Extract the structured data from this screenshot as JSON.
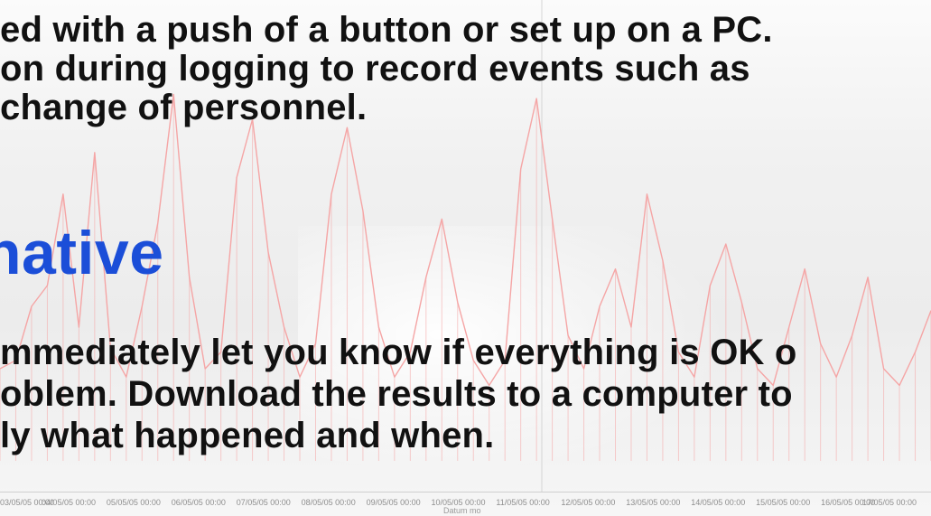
{
  "slide": {
    "lines": [
      "ed with a push of a button or set up on a PC.",
      "on during logging to record events such as",
      "change of personnel."
    ],
    "heading": "native",
    "body": [
      "mmediately let you know if everything is OK o",
      "oblem. Download the results to a computer to",
      "ly what happened and when."
    ]
  },
  "chart_data": {
    "type": "line",
    "title": "",
    "xlabel": "Datum mo",
    "ylabel": "",
    "categories": [
      "03/05/05 00:00",
      "04/05/05 00:00",
      "05/05/05 00:00",
      "06/05/05 00:00",
      "07/05/05 00:00",
      "08/05/05 00:00",
      "09/05/05 00:00",
      "10/05/05 00:00",
      "11/05/05 00:00",
      "12/05/05 00:00",
      "13/05/05 00:00",
      "14/05/05 00:00",
      "15/05/05 00:00",
      "16/05/05 00:00",
      "17/05/05 00:00"
    ],
    "series_values": [
      0.2,
      0.22,
      0.35,
      0.4,
      0.62,
      0.3,
      0.72,
      0.25,
      0.18,
      0.35,
      0.55,
      0.86,
      0.42,
      0.2,
      0.24,
      0.66,
      0.8,
      0.48,
      0.3,
      0.18,
      0.26,
      0.62,
      0.78,
      0.58,
      0.3,
      0.18,
      0.24,
      0.42,
      0.56,
      0.36,
      0.22,
      0.16,
      0.22,
      0.68,
      0.85,
      0.56,
      0.28,
      0.2,
      0.35,
      0.44,
      0.3,
      0.62,
      0.46,
      0.24,
      0.18,
      0.4,
      0.5,
      0.36,
      0.2,
      0.16,
      0.3,
      0.44,
      0.26,
      0.18,
      0.28,
      0.42,
      0.2,
      0.16,
      0.24,
      0.34
    ],
    "color": "#f5a5a5",
    "grid": false
  }
}
